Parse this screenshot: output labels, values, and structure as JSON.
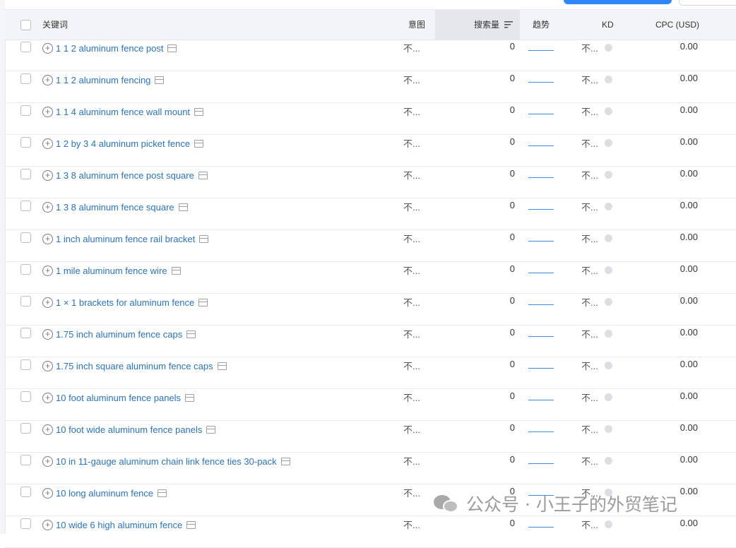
{
  "header": {
    "keyword": "关键词",
    "intent": "意图",
    "volume": "搜索量",
    "trend": "趋势",
    "kd": "KD",
    "cpc": "CPC (USD)"
  },
  "rows": [
    {
      "keyword": "1 1 2 aluminum fence post",
      "intent": "不...",
      "volume": "0",
      "kd": "不...",
      "cpc": "0.00"
    },
    {
      "keyword": "1 1 2 aluminum fencing",
      "intent": "不...",
      "volume": "0",
      "kd": "不...",
      "cpc": "0.00"
    },
    {
      "keyword": "1 1 4 aluminum fence wall mount",
      "intent": "不...",
      "volume": "0",
      "kd": "不...",
      "cpc": "0.00"
    },
    {
      "keyword": "1 2 by 3 4 aluminum picket fence",
      "intent": "不...",
      "volume": "0",
      "kd": "不...",
      "cpc": "0.00"
    },
    {
      "keyword": "1 3 8 aluminum fence post square",
      "intent": "不...",
      "volume": "0",
      "kd": "不...",
      "cpc": "0.00"
    },
    {
      "keyword": "1 3 8 aluminum fence square",
      "intent": "不...",
      "volume": "0",
      "kd": "不...",
      "cpc": "0.00"
    },
    {
      "keyword": "1 inch aluminum fence rail bracket",
      "intent": "不...",
      "volume": "0",
      "kd": "不...",
      "cpc": "0.00"
    },
    {
      "keyword": "1 mile aluminum fence wire",
      "intent": "不...",
      "volume": "0",
      "kd": "不...",
      "cpc": "0.00"
    },
    {
      "keyword": "1 × 1 brackets for aluminum fence",
      "intent": "不...",
      "volume": "0",
      "kd": "不...",
      "cpc": "0.00"
    },
    {
      "keyword": "1.75 inch aluminum fence caps",
      "intent": "不...",
      "volume": "0",
      "kd": "不...",
      "cpc": "0.00"
    },
    {
      "keyword": "1.75 inch square aluminum fence caps",
      "intent": "不...",
      "volume": "0",
      "kd": "不...",
      "cpc": "0.00"
    },
    {
      "keyword": "10 foot aluminum fence panels",
      "intent": "不...",
      "volume": "0",
      "kd": "不...",
      "cpc": "0.00"
    },
    {
      "keyword": "10 foot wide aluminum fence panels",
      "intent": "不...",
      "volume": "0",
      "kd": "不...",
      "cpc": "0.00"
    },
    {
      "keyword": "10 in 11-gauge aluminum chain link fence ties 30-pack",
      "intent": "不...",
      "volume": "0",
      "kd": "不...",
      "cpc": "0.00"
    },
    {
      "keyword": "10 long aluminum fence",
      "intent": "不...",
      "volume": "0",
      "kd": "不...",
      "cpc": "0.00"
    },
    {
      "keyword": "10 wide 6 high aluminum fence",
      "intent": "不...",
      "volume": "0",
      "kd": "不...",
      "cpc": "0.00"
    }
  ],
  "watermark": {
    "icon": "wechat-icon",
    "text": "公众号 · 小王子的外贸笔记"
  },
  "colors": {
    "link": "#2b73b6",
    "trend": "#3b8de0",
    "header_bg": "#f3f4f7",
    "sorted_header_bg": "#e5e7ec"
  }
}
